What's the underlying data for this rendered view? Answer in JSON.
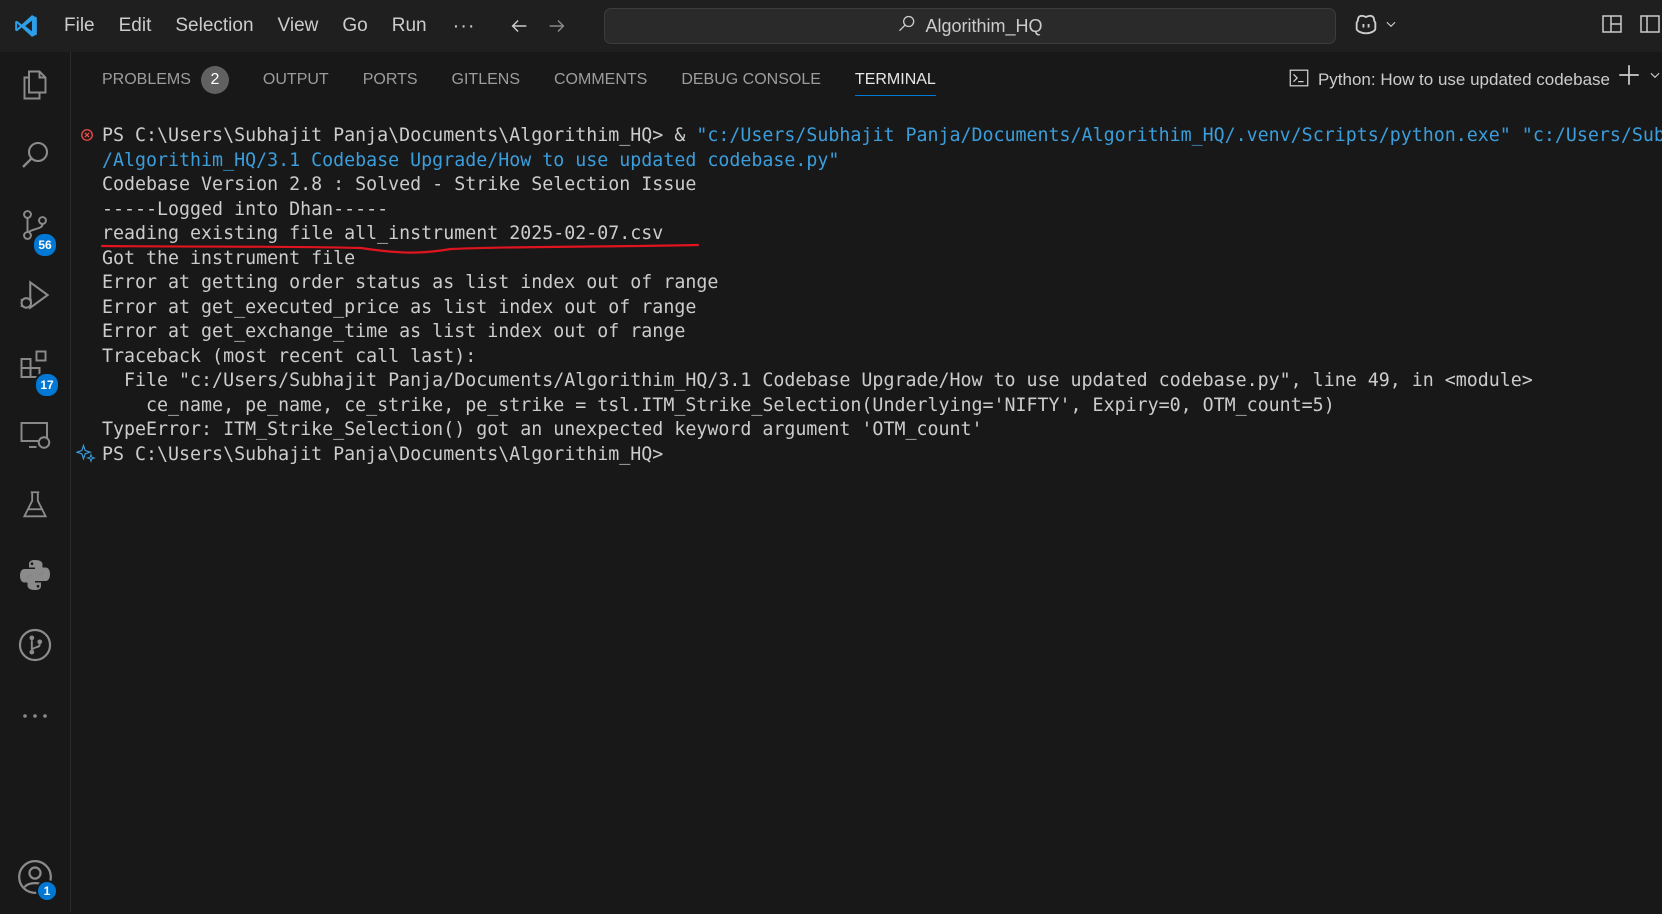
{
  "menu": [
    "File",
    "Edit",
    "Selection",
    "View",
    "Go",
    "Run"
  ],
  "menu_more": "···",
  "search": {
    "text": "Algorithim_HQ",
    "icon": "search-icon"
  },
  "activity_badges": {
    "source_control": "56",
    "extensions": "17",
    "accounts": "1"
  },
  "tabs": [
    {
      "label": "PROBLEMS",
      "count": "2"
    },
    {
      "label": "OUTPUT"
    },
    {
      "label": "PORTS"
    },
    {
      "label": "GITLENS"
    },
    {
      "label": "COMMENTS"
    },
    {
      "label": "DEBUG CONSOLE"
    },
    {
      "label": "TERMINAL"
    }
  ],
  "terminal_title": "Python: How to use updated codebase",
  "terminal": {
    "cmd_prompt": "PS C:\\Users\\Subhajit Panja\\Documents\\Algorithim_HQ> & ",
    "cmd_args_1": "\"c:/Users/Subhajit Panja/Documents/Algorithim_HQ/.venv/Scripts/python.exe\" \"c:/Users/Sub",
    "cmd_args_2": "/Algorithim_HQ/3.1 Codebase Upgrade/How to use updated codebase.py\"",
    "lines": [
      "Codebase Version 2.8 : Solved - Strike Selection Issue",
      "-----Logged into Dhan-----",
      "reading existing file all_instrument 2025-02-07.csv",
      "Got the instrument file",
      "Error at getting order status as list index out of range",
      "Error at get_executed_price as list index out of range",
      "Error at get_exchange_time as list index out of range",
      "Traceback (most recent call last):",
      "  File \"c:/Users/Subhajit Panja/Documents/Algorithim_HQ/3.1 Codebase Upgrade/How to use updated codebase.py\", line 49, in <module>",
      "    ce_name, pe_name, ce_strike, pe_strike = tsl.ITM_Strike_Selection(Underlying='NIFTY', Expiry=0, OTM_count=5)",
      "TypeError: ITM_Strike_Selection() got an unexpected keyword argument 'OTM_count'"
    ],
    "final_prompt": "PS C:\\Users\\Subhajit Panja\\Documents\\Algorithim_HQ>"
  },
  "colors": {
    "accent": "#0078d4",
    "path_blue": "#3b9edc",
    "error_red": "#f14c4c",
    "annotation_red": "#e0141e"
  }
}
